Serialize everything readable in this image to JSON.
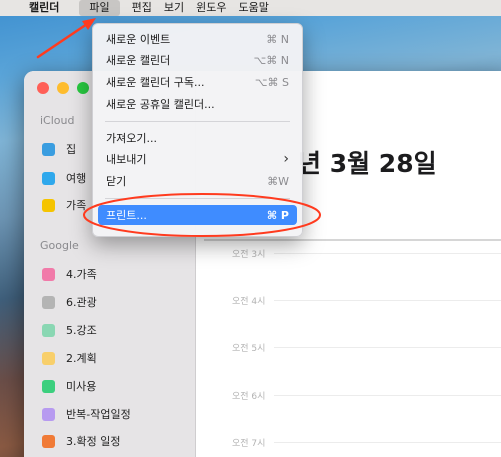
{
  "menubar": {
    "apple_icon": "",
    "app_name": "캘린더",
    "items": [
      "파일",
      "편집",
      "보기",
      "윈도우",
      "도움말"
    ]
  },
  "sidebar": {
    "icloud_title": "iCloud",
    "icloud_items": [
      {
        "label": "집",
        "color": "#3a9de0"
      },
      {
        "label": "여행",
        "color": "#2fa8ec"
      },
      {
        "label": "가족",
        "color": "#f5c400"
      }
    ],
    "google_title": "Google",
    "google_items": [
      {
        "label": "4.가족",
        "color": "#f17aa9"
      },
      {
        "label": "6.관광",
        "color": "#b4b4b4"
      },
      {
        "label": "5.강조",
        "color": "#8ad7b3"
      },
      {
        "label": "2.계획",
        "color": "#f8cf6b"
      },
      {
        "label": "미사용",
        "color": "#3ccf7e"
      },
      {
        "label": "반복-작업일정",
        "color": "#b79af0"
      },
      {
        "label": "3.확정 일정",
        "color": "#f07a36"
      }
    ]
  },
  "main": {
    "date_title": "년 3월 28일",
    "times": [
      "오전 3시",
      "오전 4시",
      "오전 5시",
      "오전 6시",
      "오전 7시"
    ]
  },
  "file_menu": {
    "items": [
      {
        "label": "새로운 이벤트",
        "shortcut": "⌘ N"
      },
      {
        "label": "새로운 캘린더",
        "shortcut": "⌥⌘ N"
      },
      {
        "label": "새로운 캘린더 구독...",
        "shortcut": "⌥⌘ S"
      },
      {
        "label": "새로운 공휴일 캘린더...",
        "shortcut": ""
      },
      {
        "label": "가져오기...",
        "shortcut": ""
      },
      {
        "label": "내보내기",
        "shortcut": "›"
      },
      {
        "label": "닫기",
        "shortcut": "⌘W"
      },
      {
        "label": "프린트...",
        "shortcut": "⌘ P"
      }
    ]
  }
}
